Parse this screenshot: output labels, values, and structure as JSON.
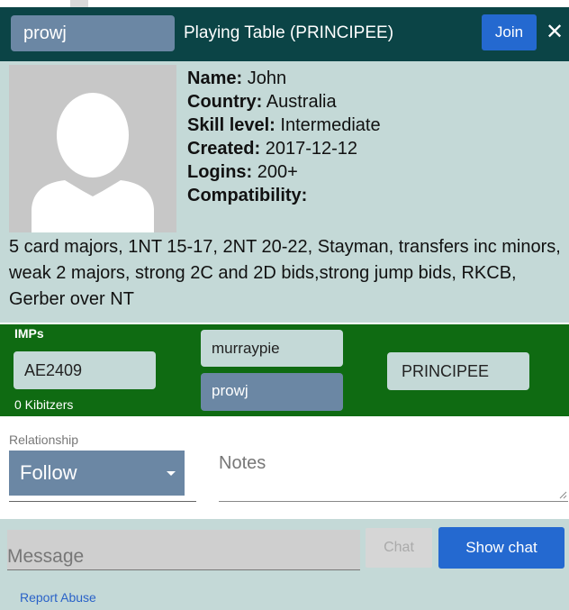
{
  "header": {
    "username": "prowj",
    "table_title": "Playing Table (PRINCIPEE)",
    "join_label": "Join",
    "close_glyph": "✕"
  },
  "profile": {
    "name_label": "Name:",
    "name_value": "John",
    "country_label": "Country:",
    "country_value": "Australia",
    "skill_label": "Skill level:",
    "skill_value": "Intermediate",
    "created_label": "Created:",
    "created_value": "2017-12-12",
    "logins_label": "Logins:",
    "logins_value": "200+",
    "compat_label": "Compatibility:",
    "compat_text": "5 card majors, 1NT 15-17, 2NT 20-22, Stayman, transfers inc minors, weak 2 majors, strong 2C and 2D bids,strong jump bids, RKCB, Gerber over NT"
  },
  "table": {
    "scoring": "IMPs",
    "west": "AE2409",
    "north": "murraypie",
    "south": "prowj",
    "east": "PRINCIPEE",
    "kibitzers": "0 Kibitzers"
  },
  "relationship": {
    "label": "Relationship",
    "selected": "Follow",
    "notes_placeholder": "Notes"
  },
  "chat": {
    "message_placeholder": "Message",
    "chat_label": "Chat",
    "show_chat_label": "Show chat",
    "report_label": "Report Abuse"
  },
  "colors": {
    "header_bg": "#0b4446",
    "panel_bg": "#c4d9d7",
    "table_green": "#0f6b12",
    "accent_blue": "#2469d0",
    "slate": "#6b87a4"
  }
}
